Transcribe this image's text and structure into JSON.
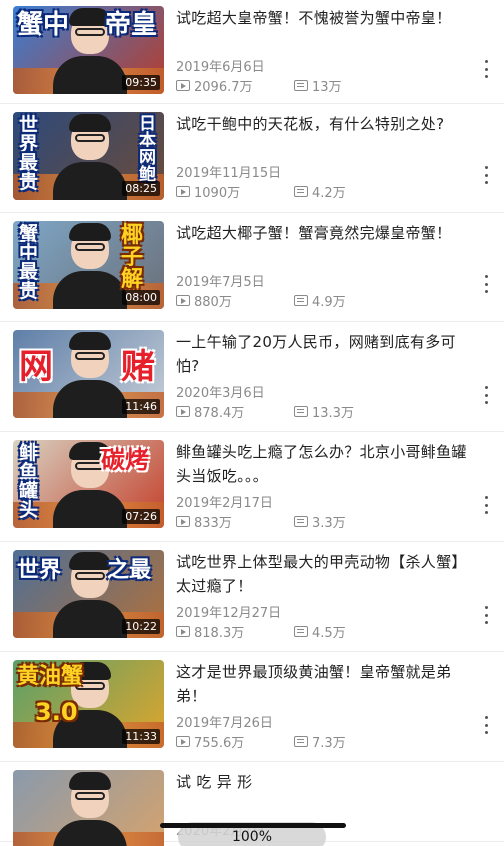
{
  "videos": [
    {
      "title": "试吃超大皇帝蟹！不愧被誉为蟹中帝皇！",
      "date": "2019年6月6日",
      "views": "2096.7万",
      "comments": "13万",
      "duration": "09:35",
      "captions": [
        "蟹中",
        "帝皇"
      ],
      "bg": [
        "#3a7fd4",
        "#b83c2a"
      ]
    },
    {
      "title": "试吃干鲍中的天花板，有什么特别之处?",
      "date": "2019年11月15日",
      "views": "1090万",
      "comments": "4.2万",
      "duration": "08:25",
      "captions": [
        "世界最贵",
        "日本网鲍"
      ],
      "bg": [
        "#2c4a7c",
        "#6d4b36"
      ]
    },
    {
      "title": "试吃超大椰子蟹！蟹膏竟然完爆皇帝蟹！",
      "date": "2019年7月5日",
      "views": "880万",
      "comments": "4.9万",
      "duration": "08:00",
      "captions": [
        "蟹中最贵",
        "椰子解"
      ],
      "bg": [
        "#7ea7c7",
        "#6b6f78"
      ]
    },
    {
      "title": "一上午输了20万人民币，网赌到底有多可怕?",
      "date": "2020年3月6日",
      "views": "878.4万",
      "comments": "13.3万",
      "duration": "11:46",
      "captions": [
        "网",
        "赌"
      ],
      "bg": [
        "#5f7fa8",
        "#c7cfd8"
      ]
    },
    {
      "title": "鲱鱼罐头吃上瘾了怎么办？北京小哥鲱鱼罐头当饭吃。。。",
      "date": "2019年2月17日",
      "views": "833万",
      "comments": "3.3万",
      "duration": "07:26",
      "captions": [
        "鲱鱼罐头",
        "碳烤"
      ],
      "bg": [
        "#d8d2c2",
        "#c33f2a"
      ]
    },
    {
      "title": "试吃世界上体型最大的甲壳动物【杀人蟹】太过瘾了！",
      "date": "2019年12月27日",
      "views": "818.3万",
      "comments": "4.5万",
      "duration": "10:22",
      "captions": [
        "世界",
        "之最"
      ],
      "bg": [
        "#4f6f96",
        "#b1713a"
      ]
    },
    {
      "title": "这才是世界最顶级黄油蟹！皇帝蟹就是弟弟！",
      "date": "2019年7月26日",
      "views": "755.6万",
      "comments": "7.3万",
      "duration": "11:33",
      "captions": [
        "黄油蟹",
        "3.0"
      ],
      "bg": [
        "#5aa06a",
        "#e0a52c"
      ]
    },
    {
      "title": "试 吃 异 形",
      "date": "2020年2月7日",
      "views": "",
      "comments": "",
      "duration": "",
      "captions": [],
      "bg": [
        "#8a9aac",
        "#d9a36a"
      ]
    }
  ],
  "toast": "100%"
}
